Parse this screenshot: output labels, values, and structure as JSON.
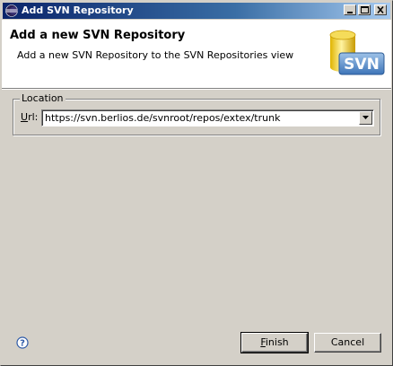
{
  "window": {
    "title": "Add SVN Repository"
  },
  "header": {
    "title": "Add a new SVN Repository",
    "description": "Add a new SVN Repository to the SVN Repositories view",
    "graphic_text": "SVN"
  },
  "location": {
    "legend": "Location",
    "url_label_mnemonic": "U",
    "url_label_rest": "rl:",
    "url_value": "https://svn.berlios.de/svnroot/repos/extex/trunk"
  },
  "buttons": {
    "finish_mnemonic": "F",
    "finish_rest": "inish",
    "cancel": "Cancel"
  },
  "colors": {
    "title_gradient_start": "#0a246a",
    "title_gradient_end": "#a6caf0",
    "face": "#d4d0c8"
  }
}
